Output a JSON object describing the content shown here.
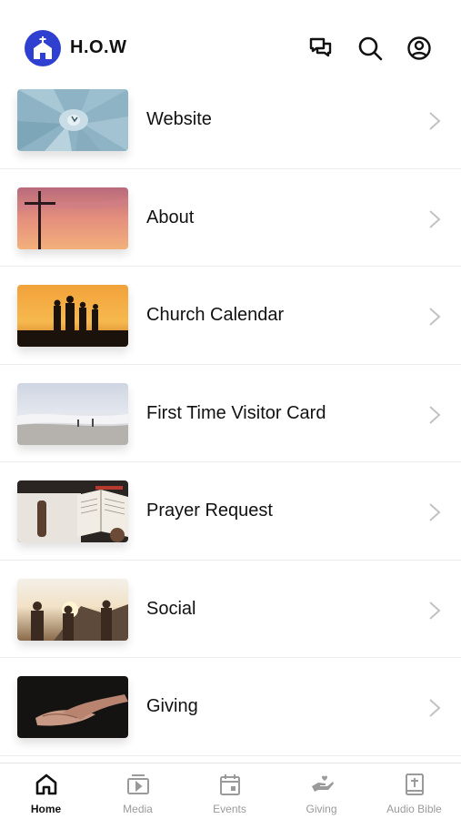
{
  "header": {
    "title": "H.O.W",
    "icons": [
      "church-logo-icon",
      "chat-icon",
      "search-icon",
      "account-icon"
    ]
  },
  "menu": [
    {
      "label": "Website",
      "thumb": "agave-plant"
    },
    {
      "label": "About",
      "thumb": "cross-sunset"
    },
    {
      "label": "Church Calendar",
      "thumb": "family-sunset"
    },
    {
      "label": "First Time Visitor Card",
      "thumb": "beach-waves"
    },
    {
      "label": "Prayer Request",
      "thumb": "bible-reading"
    },
    {
      "label": "Social",
      "thumb": "friends-sunset"
    },
    {
      "label": "Giving",
      "thumb": "open-hands"
    }
  ],
  "tabs": [
    {
      "label": "Home",
      "icon": "home-icon",
      "active": true
    },
    {
      "label": "Media",
      "icon": "media-icon",
      "active": false
    },
    {
      "label": "Events",
      "icon": "calendar-icon",
      "active": false
    },
    {
      "label": "Giving",
      "icon": "giving-hand-icon",
      "active": false
    },
    {
      "label": "Audio Bible",
      "icon": "bible-icon",
      "active": false
    }
  ],
  "colors": {
    "brand": "#2f3fd0",
    "divider": "#ececec",
    "tab_inactive": "#9a9a9a",
    "tab_active": "#111111"
  }
}
